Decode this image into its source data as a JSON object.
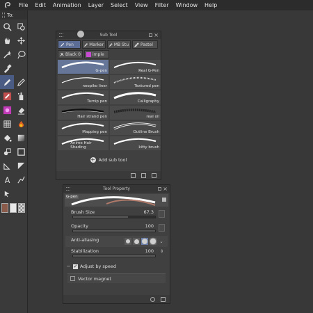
{
  "menubar": {
    "logo": "clip-studio-logo",
    "items": [
      "File",
      "Edit",
      "Animation",
      "Layer",
      "Select",
      "View",
      "Filter",
      "Window",
      "Help"
    ]
  },
  "toolbar": {
    "header": "To:",
    "tools": [
      {
        "icon": "zoom-icon"
      },
      {
        "icon": "search-hand-icon"
      },
      {
        "icon": "hand-icon"
      },
      {
        "icon": "move-icon"
      },
      {
        "icon": "magic-wand-icon"
      },
      {
        "icon": "lasso-icon"
      },
      {
        "icon": "eyedropper-icon"
      },
      {
        "icon": ""
      },
      {
        "icon": "pen-icon",
        "active": true
      },
      {
        "icon": "pencil-icon"
      },
      {
        "icon": "brush-icon"
      },
      {
        "icon": "airbrush-icon"
      },
      {
        "icon": "decoration-icon"
      },
      {
        "icon": "eraser-icon"
      },
      {
        "icon": "grid-icon"
      },
      {
        "icon": "blend-icon"
      },
      {
        "icon": "fill-icon"
      },
      {
        "icon": "gradient-icon"
      },
      {
        "icon": "figure-icon"
      },
      {
        "icon": "frame-icon"
      },
      {
        "icon": "ruler-icon"
      },
      {
        "icon": "shape-icon"
      },
      {
        "icon": "text-icon"
      },
      {
        "icon": "balloon-icon"
      },
      {
        "icon": "correct-line-icon"
      },
      {
        "icon": ""
      }
    ],
    "colors": {
      "main": "#8a5a4a",
      "sub": "#e8e8e8"
    }
  },
  "subtool": {
    "title": "Sub Tool",
    "tabs": [
      {
        "label": "Pen",
        "icon": "pen-icon",
        "active": true
      },
      {
        "label": "Marker",
        "icon": "marker-icon"
      },
      {
        "label": "MB Stu",
        "icon": "pen-icon"
      },
      {
        "label": "Pastel",
        "icon": "pastel-icon"
      },
      {
        "label": "Black 0",
        "icon": "brush-icon"
      },
      {
        "label": "imple",
        "icon": "pink-icon"
      }
    ],
    "brushes": [
      {
        "label": "G-pen",
        "active": true
      },
      {
        "label": "Real G-Pen"
      },
      {
        "label": "neopiko liner"
      },
      {
        "label": "Textured pen"
      },
      {
        "label": "Turnip pen"
      },
      {
        "label": "Calligraphy"
      },
      {
        "label": "Hair strand pen"
      },
      {
        "label": "real oil"
      },
      {
        "label": "Mapping pen"
      },
      {
        "label": "Outline Brush"
      },
      {
        "label": "Anime Hair Shading"
      },
      {
        "label": "kitty brush"
      }
    ],
    "add_label": "Add sub tool"
  },
  "toolprop": {
    "title": "Tool Property",
    "preview_name": "G-pen",
    "brush_size": {
      "label": "Brush Size",
      "value": "67.3",
      "fraction": 0.67
    },
    "opacity": {
      "label": "Opacity",
      "value": "100",
      "fraction": 1.0
    },
    "anti_aliasing": {
      "label": "Anti-aliasing",
      "selected": 2
    },
    "stabilization": {
      "label": "Stabilization",
      "value": "100",
      "fraction": 1.0
    },
    "adjust_by_speed": {
      "label": "Adjust by speed",
      "checked": true
    },
    "vector_magnet": {
      "label": "Vector magnet",
      "checked": false
    }
  }
}
